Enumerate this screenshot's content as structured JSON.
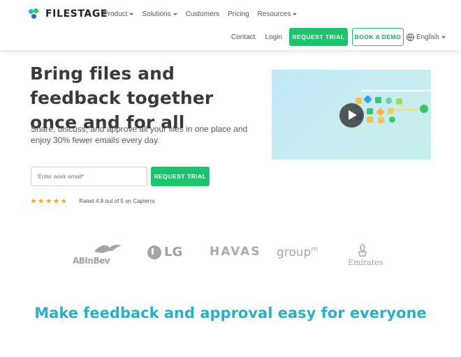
{
  "header": {
    "brand": "FILESTAGE",
    "nav": [
      {
        "label": "Product",
        "has_dropdown": true
      },
      {
        "label": "Solutions",
        "has_dropdown": true
      },
      {
        "label": "Customers",
        "has_dropdown": false
      },
      {
        "label": "Pricing",
        "has_dropdown": false
      },
      {
        "label": "Resources",
        "has_dropdown": true
      }
    ],
    "contact": "Contact",
    "login": "Login",
    "request_trial": "REQUEST TRIAL",
    "book_demo": "BOOK A DEMO",
    "language": "English"
  },
  "hero": {
    "headline": "Bring files and feedback together once and for all",
    "subheadline": "Share, discuss, and approve all your files in one place and enjoy 30% fewer emails every day.",
    "email_placeholder": "Enter work email*",
    "email_value": "",
    "cta": "REQUEST TRIAL",
    "rating_stars": 4.8,
    "rating_text": "Rated 4.8 out of 5 on Capterra"
  },
  "logos": {
    "abinbev": "ABInBev",
    "lg": "LG",
    "havas": "HAVAS",
    "groupm": "group",
    "groupm_sup": "m",
    "emirates": "Emirates"
  },
  "section": {
    "title": "Make feedback and approval easy for everyone"
  },
  "colors": {
    "accent_green": "#1ec36d",
    "heading_teal": "#2aaec9",
    "star": "#f2a81d"
  },
  "icons": {
    "globe": "globe-icon",
    "play": "play-icon",
    "star": "star-icon"
  }
}
